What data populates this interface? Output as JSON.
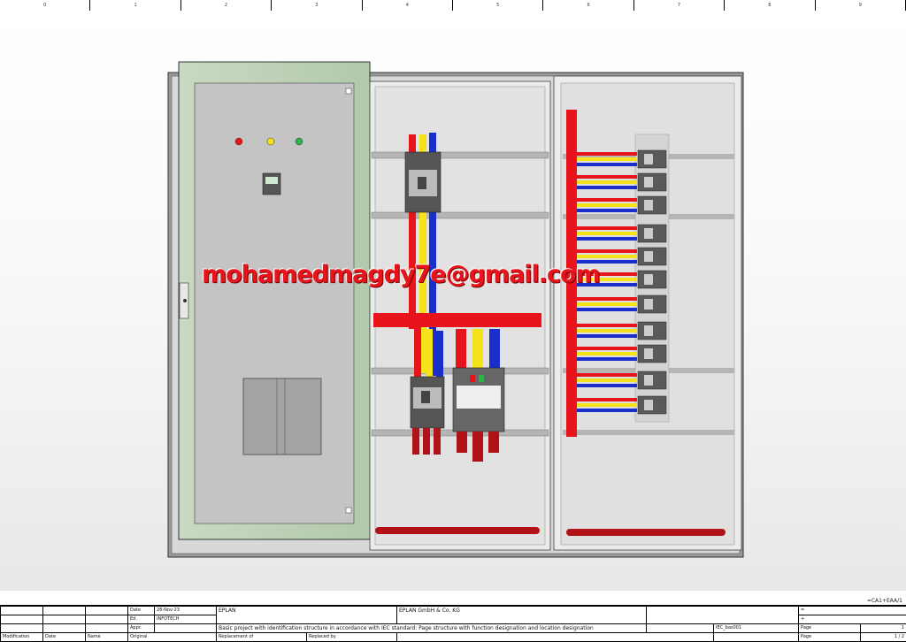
{
  "ruler": {
    "columns": [
      "0",
      "1",
      "2",
      "3",
      "4",
      "5",
      "6",
      "7",
      "8",
      "9"
    ]
  },
  "watermark": {
    "text": "mohamedmagdy7e@gmail.com"
  },
  "page_ref": "=CA1+EAA/1",
  "title_block": {
    "date_label": "Date",
    "date_value": "28-Nov-23",
    "ed_label": "Ed.",
    "ed_value": "INFOTECH",
    "appr_label": "Appr.",
    "modification_label": "Modification",
    "date_col_label": "Date",
    "name_col_label": "Name",
    "original_label": "Original",
    "replacement_of_label": "Replacement of",
    "replaced_by_label": "Replaced by",
    "company": "EPLAN",
    "company_full": "EPLAN GmbH & Co. KG",
    "description": "Basic project with identification structure in accordance with IEC standard: Page structure with function designation and location designation",
    "project": "IEC_bas001",
    "eq_sign": "=",
    "plus_sign": "+",
    "page_label": "Page",
    "page_value": "1",
    "page_label2": "Page",
    "page_total": "1 / 2"
  },
  "colors": {
    "phase_l1": "#e8141c",
    "phase_l2": "#f5e21a",
    "phase_l3": "#1a2ecc",
    "door_panel": "#b8d0b0",
    "cabinet_frame": "#8a8a8a"
  },
  "indicator_lamps": [
    "red-lamp",
    "yellow-lamp",
    "green-lamp"
  ]
}
